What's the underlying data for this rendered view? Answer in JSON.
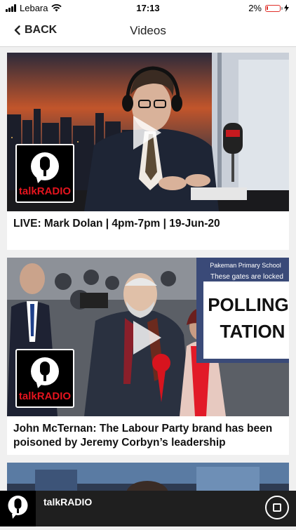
{
  "status_bar": {
    "carrier": "Lebara",
    "time": "17:13",
    "battery_percent": "2%",
    "battery_color": "#e0302a"
  },
  "nav": {
    "back_label": "BACK",
    "title": "Videos"
  },
  "videos": [
    {
      "title": "LIVE: Mark Dolan | 4pm-7pm | 19-Jun-20",
      "logo_text": "talkRADIO"
    },
    {
      "title": "John McTernan: The Labour Party brand has been poisoned by Jeremy Corbyn’s leadership",
      "logo_text": "talkRADIO",
      "sign_school": "Pakeman Primary School",
      "sign_gates": "These gates are locked",
      "sign_line1": "POLLING",
      "sign_line2": "TATION"
    }
  ],
  "player": {
    "station": "talkRADIO"
  },
  "colors": {
    "brand_red": "#e4141e",
    "player_bg": "#1f1f1f"
  }
}
